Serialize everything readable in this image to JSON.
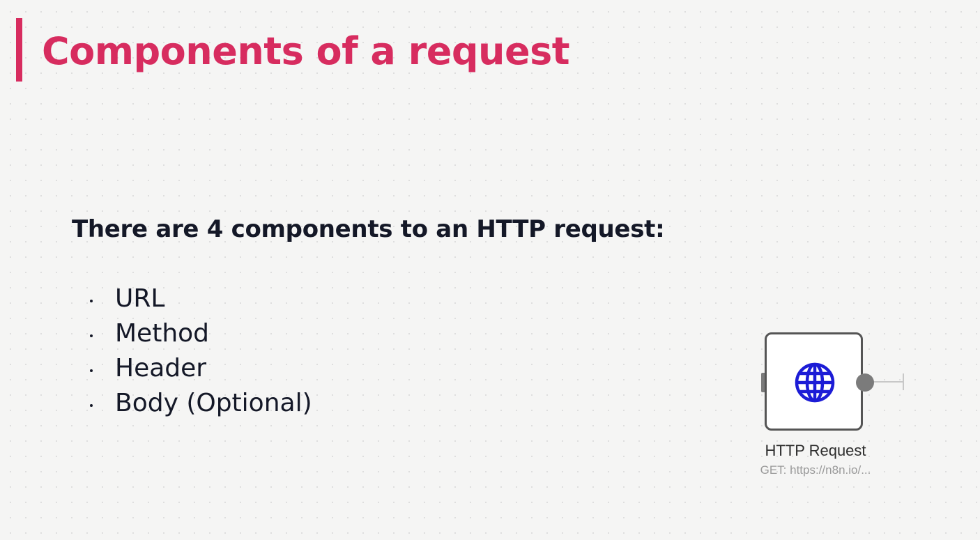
{
  "slide": {
    "title": "Components of a request",
    "intro": "There are 4 components to an HTTP request:",
    "components": [
      "URL",
      "Method",
      "Header",
      "Body (Optional)"
    ]
  },
  "node": {
    "name": "HTTP Request",
    "subtitle": "GET: https://n8n.io/...",
    "icon": "globe-icon"
  },
  "colors": {
    "accent": "#d72c5f",
    "text": "#141827",
    "node_border": "#555555",
    "node_icon": "#1c1cd6",
    "handle": "#7b7b7b"
  }
}
